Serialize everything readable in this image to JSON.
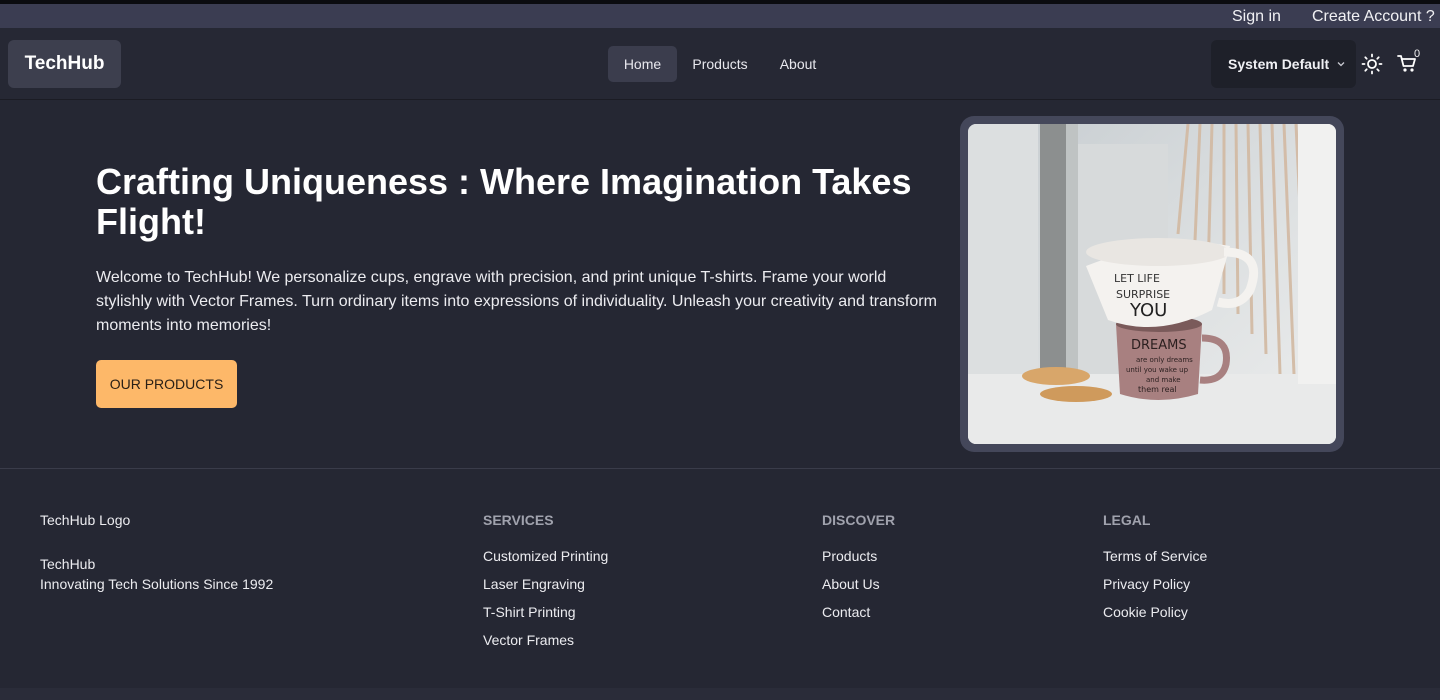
{
  "auth": {
    "sign_in": "Sign in",
    "create_account": "Create Account ?"
  },
  "nav": {
    "brand": "TechHub",
    "links": [
      {
        "label": "Home",
        "active": true
      },
      {
        "label": "Products"
      },
      {
        "label": "About"
      }
    ],
    "theme_select": "System Default",
    "cart_count": "0",
    "icons": [
      "chevron-down-icon",
      "sun-icon",
      "cart-icon"
    ]
  },
  "hero": {
    "title": "Crafting Uniqueness : Where Imagination Takes Flight!",
    "text": "Welcome to TechHub! We personalize cups, engrave with precision, and print unique T-shirts. Frame your world stylishly with Vector Frames. Turn ordinary items into expressions of individuality. Unleash your creativity and transform moments into memories!",
    "cta": "OUR PRODUCTS",
    "image": {
      "mug_top_text": [
        "LET LIFE",
        "SURPRISE",
        "YOU"
      ],
      "mug_bottom_text": [
        "DREAMS",
        "are only dreams",
        "until you wake up",
        "and make",
        "them real"
      ]
    }
  },
  "footer": {
    "logo": "TechHub Logo",
    "name": "TechHub",
    "tagline": "Innovating Tech Solutions Since 1992",
    "columns": [
      {
        "heading": "SERVICES",
        "links": [
          "Customized Printing",
          "Laser Engraving",
          "T-Shirt Printing",
          "Vector Frames"
        ]
      },
      {
        "heading": "DISCOVER",
        "links": [
          "Products",
          "About Us",
          "Contact"
        ]
      },
      {
        "heading": "LEGAL",
        "links": [
          "Terms of Service",
          "Privacy Policy",
          "Cookie Policy"
        ]
      }
    ]
  },
  "colors": {
    "accent": "#fdb869",
    "background": "#252733",
    "topbar": "#3b3d52"
  }
}
